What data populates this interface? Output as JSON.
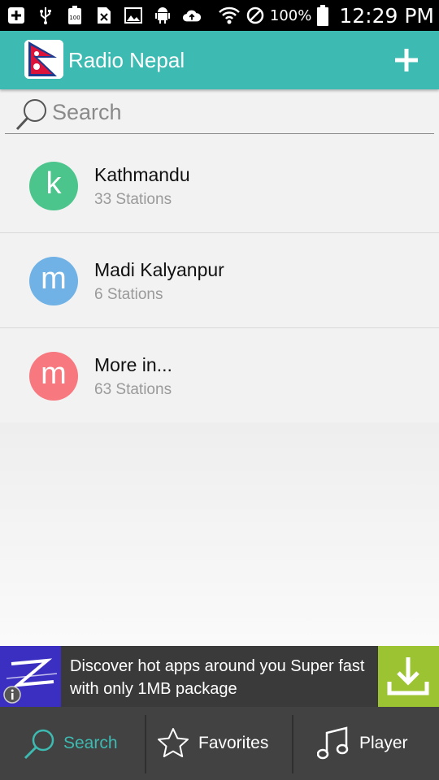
{
  "status_bar": {
    "battery_percent": "100%",
    "time": "12:29 PM",
    "icons": [
      "add-box-icon",
      "usb-icon",
      "battery-100-icon",
      "sim-icon",
      "image-icon",
      "android-icon",
      "cloud-upload-icon",
      "wifi-icon",
      "do-not-disturb-icon",
      "battery-icon"
    ]
  },
  "app_bar": {
    "title": "Radio Nepal",
    "logo": "nepal-flag-icon",
    "action_icon": "plus-icon",
    "color": "#3dbab1"
  },
  "search": {
    "placeholder": "Search",
    "value": ""
  },
  "list": [
    {
      "letter": "k",
      "title": "Kathmandu",
      "subtitle": "33 Stations",
      "color": "#4cc58c"
    },
    {
      "letter": "m",
      "title": "Madi Kalyanpur",
      "subtitle": "6 Stations",
      "color": "#70b2e6"
    },
    {
      "letter": "m",
      "title": "More in...",
      "subtitle": "63 Stations",
      "color": "#f7787e"
    }
  ],
  "ad": {
    "line1": "Discover hot apps around you Super fast",
    "line2": "with only 1MB package",
    "logo_icon": "z-logo-icon",
    "info_icon": "info-icon",
    "download_icon": "download-icon"
  },
  "bottom_nav": {
    "items": [
      {
        "label": "Search",
        "icon": "search-icon",
        "active": true
      },
      {
        "label": "Favorites",
        "icon": "star-icon",
        "active": false
      },
      {
        "label": "Player",
        "icon": "music-note-icon",
        "active": false
      }
    ],
    "active_color": "#3dbab1",
    "inactive_color": "#ffffff"
  }
}
